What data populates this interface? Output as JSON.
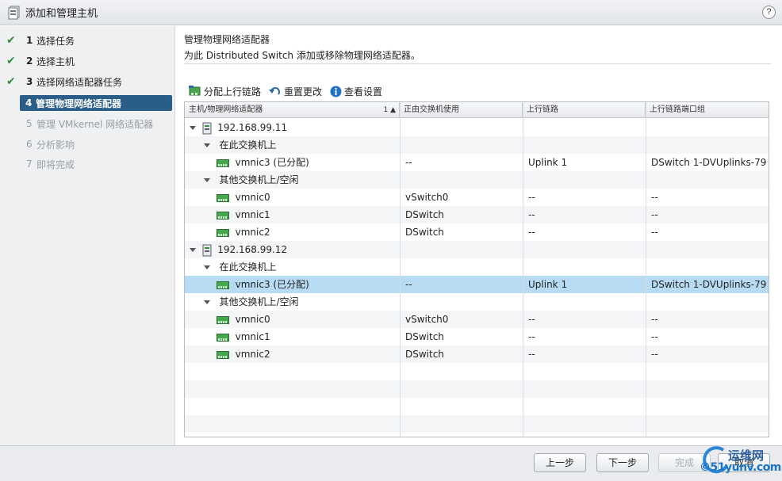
{
  "window": {
    "title": "添加和管理主机",
    "help_label": "?"
  },
  "steps": [
    {
      "num": "1",
      "label": "选择任务",
      "state": "done"
    },
    {
      "num": "2",
      "label": "选择主机",
      "state": "done"
    },
    {
      "num": "3",
      "label": "选择网络适配器任务",
      "state": "done"
    },
    {
      "num": "4",
      "label": "管理物理网络适配器",
      "state": "active"
    },
    {
      "num": "5",
      "label": "管理 VMkernel 网络适配器",
      "state": "todo"
    },
    {
      "num": "6",
      "label": "分析影响",
      "state": "todo"
    },
    {
      "num": "7",
      "label": "即将完成",
      "state": "todo"
    }
  ],
  "main": {
    "heading": "管理物理网络适配器",
    "subheading": "为此 Distributed Switch 添加或移除物理网络适配器。"
  },
  "toolbar": {
    "assign_uplink": "分配上行链路",
    "reset_changes": "重置更改",
    "view_settings": "查看设置"
  },
  "grid": {
    "columns": [
      "主机/物理网络适配器",
      "正由交换机使用",
      "上行链路",
      "上行链路端口组"
    ],
    "sort_indicator": "1 ▲",
    "rows": [
      {
        "kind": "host",
        "c1": "192.168.99.11",
        "c2": "",
        "c3": "",
        "c4": ""
      },
      {
        "kind": "group",
        "c1": "在此交换机上",
        "c2": "",
        "c3": "",
        "c4": ""
      },
      {
        "kind": "nic",
        "c1": "vmnic3 (已分配)",
        "c2": "--",
        "c3": "Uplink 1",
        "c4": "DSwitch 1-DVUplinks-79"
      },
      {
        "kind": "group",
        "c1": "其他交换机上/空闲",
        "c2": "",
        "c3": "",
        "c4": ""
      },
      {
        "kind": "nic",
        "c1": "vmnic0",
        "c2": "vSwitch0",
        "c3": "--",
        "c4": "--"
      },
      {
        "kind": "nic",
        "c1": "vmnic1",
        "c2": "DSwitch",
        "c3": "--",
        "c4": "--"
      },
      {
        "kind": "nic",
        "c1": "vmnic2",
        "c2": "DSwitch",
        "c3": "--",
        "c4": "--"
      },
      {
        "kind": "host",
        "c1": "192.168.99.12",
        "c2": "",
        "c3": "",
        "c4": ""
      },
      {
        "kind": "group",
        "c1": "在此交换机上",
        "c2": "",
        "c3": "",
        "c4": ""
      },
      {
        "kind": "nic",
        "c1": "vmnic3 (已分配)",
        "c2": "--",
        "c3": "Uplink 1",
        "c4": "DSwitch 1-DVUplinks-79",
        "selected": true
      },
      {
        "kind": "group",
        "c1": "其他交换机上/空闲",
        "c2": "",
        "c3": "",
        "c4": ""
      },
      {
        "kind": "nic",
        "c1": "vmnic0",
        "c2": "vSwitch0",
        "c3": "--",
        "c4": "--"
      },
      {
        "kind": "nic",
        "c1": "vmnic1",
        "c2": "DSwitch",
        "c3": "--",
        "c4": "--"
      },
      {
        "kind": "nic",
        "c1": "vmnic2",
        "c2": "DSwitch",
        "c3": "--",
        "c4": "--"
      }
    ]
  },
  "footer": {
    "back": "上一步",
    "next": "下一步",
    "finish": "完成",
    "cancel": "取消"
  },
  "watermark": {
    "line1": "运维网",
    "line2": "©51yunv.com"
  },
  "colors": {
    "active_step": "#2a5d87",
    "check": "#3a8d3f",
    "selected_row": "#b7dbf3"
  }
}
